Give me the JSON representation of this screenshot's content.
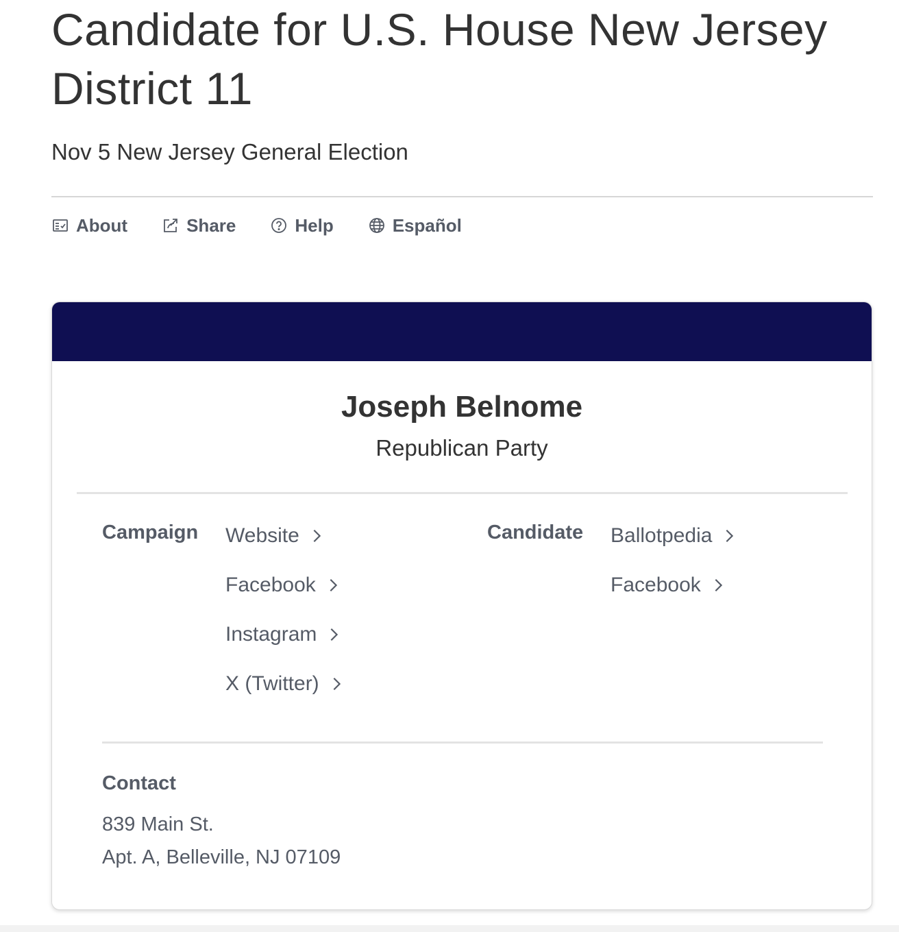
{
  "page": {
    "title": "Candidate for U.S. House New Jersey District 11",
    "subtitle": "Nov 5 New Jersey General Election"
  },
  "toolbar": {
    "items": [
      {
        "label": "About",
        "icon": "checklist-icon"
      },
      {
        "label": "Share",
        "icon": "share-icon"
      },
      {
        "label": "Help",
        "icon": "question-circle-icon"
      },
      {
        "label": "Español",
        "icon": "globe-icon"
      }
    ]
  },
  "candidate": {
    "name": "Joseph Belnome",
    "party": "Republican Party",
    "header_color": "#0f0f52",
    "campaign": {
      "label": "Campaign",
      "links": [
        "Website",
        "Facebook",
        "Instagram",
        "X (Twitter)"
      ]
    },
    "candidate_links": {
      "label": "Candidate",
      "links": [
        "Ballotpedia",
        "Facebook"
      ]
    },
    "contact": {
      "label": "Contact",
      "address_line1": "839 Main St.",
      "address_line2": "Apt. A, Belleville, NJ 07109"
    }
  }
}
